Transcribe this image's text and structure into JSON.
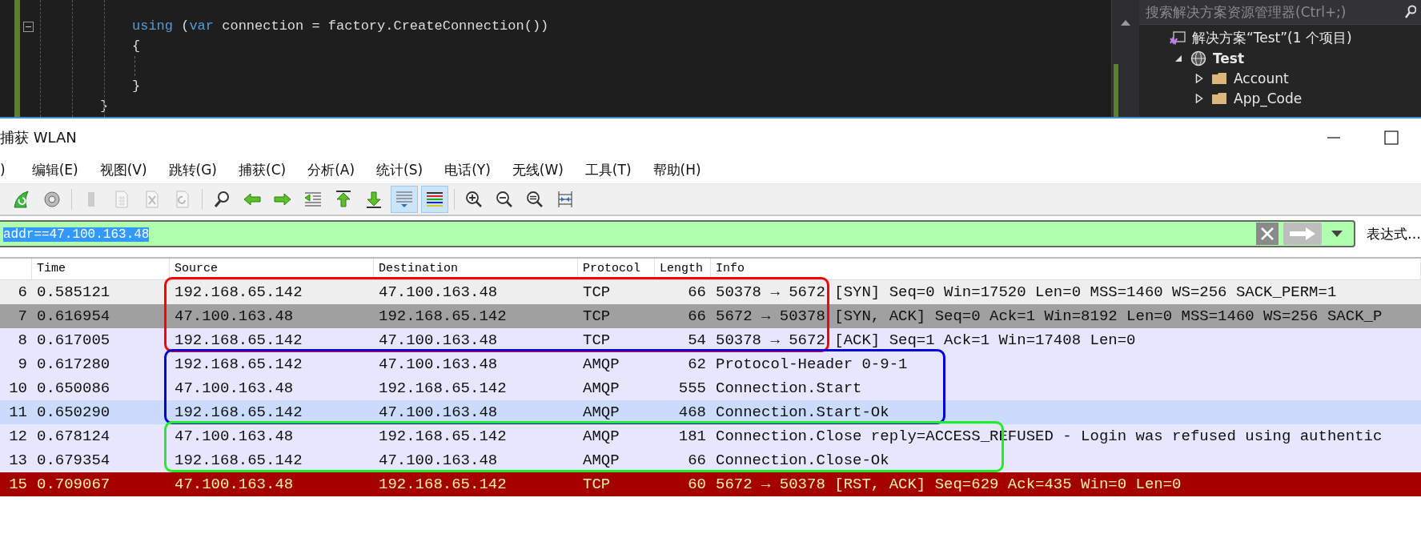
{
  "code_editor": {
    "lines": [
      {
        "kind": "inner",
        "tokens": [
          {
            "kind": "keyword",
            "text": "using"
          },
          {
            "kind": "plain",
            "text": " ("
          },
          {
            "kind": "keyword",
            "text": "var"
          },
          {
            "kind": "plain",
            "text": " connection = factory.CreateConnection())"
          }
        ]
      },
      {
        "kind": "inner",
        "tokens": [
          {
            "kind": "plain",
            "text": "{"
          }
        ]
      },
      {
        "kind": "blank"
      },
      {
        "kind": "inner",
        "tokens": [
          {
            "kind": "plain",
            "text": "}"
          }
        ]
      },
      {
        "kind": "outer",
        "tokens": [
          {
            "kind": "plain",
            "text": "}"
          }
        ]
      }
    ]
  },
  "solution_explorer": {
    "search": {
      "placeholder": "搜索解决方案资源管理器(Ctrl+;)"
    },
    "tree": [
      {
        "label": "解决方案“Test”(1 个项目)",
        "kind": "solution",
        "children": [
          {
            "label": "Test",
            "kind": "project",
            "expanded": true,
            "children": [
              {
                "label": "Account",
                "kind": "folder",
                "expanded": false
              },
              {
                "label": "App_Code",
                "kind": "folder",
                "expanded": false
              }
            ]
          }
        ]
      }
    ]
  },
  "window": {
    "title": "捕获 WLAN"
  },
  "menu": [
    ")",
    "编辑(E)",
    "视图(V)",
    "跳转(G)",
    "捕获(C)",
    "分析(A)",
    "统计(S)",
    "电话(Y)",
    "无线(W)",
    "工具(T)",
    "帮助(H)"
  ],
  "toolbar": [
    [
      {
        "kind": "restart",
        "pressed": false,
        "disabled": false
      },
      {
        "kind": "options",
        "pressed": false,
        "disabled": false
      }
    ],
    [
      {
        "kind": "save",
        "pressed": false,
        "disabled": true
      },
      {
        "kind": "file",
        "pressed": false,
        "disabled": true
      },
      {
        "kind": "close",
        "pressed": false,
        "disabled": true
      },
      {
        "kind": "reload",
        "pressed": false,
        "disabled": true
      }
    ],
    [
      {
        "kind": "find",
        "pressed": false,
        "disabled": false
      },
      {
        "kind": "back",
        "pressed": false,
        "disabled": false
      },
      {
        "kind": "forward",
        "pressed": false,
        "disabled": false
      },
      {
        "kind": "goto",
        "pressed": false,
        "disabled": false
      },
      {
        "kind": "first",
        "pressed": false,
        "disabled": false
      },
      {
        "kind": "last",
        "pressed": false,
        "disabled": false
      },
      {
        "kind": "autoscroll",
        "pressed": true,
        "disabled": false
      },
      {
        "kind": "colorize",
        "pressed": true,
        "disabled": false
      }
    ],
    [
      {
        "kind": "zoom-in",
        "pressed": false,
        "disabled": false
      },
      {
        "kind": "zoom-out",
        "pressed": false,
        "disabled": false
      },
      {
        "kind": "zoom-reset",
        "pressed": false,
        "disabled": false
      },
      {
        "kind": "resize",
        "pressed": false,
        "disabled": false
      }
    ]
  ],
  "filter": {
    "value": "addr==47.100.163.48",
    "expression_button": "表达式…"
  },
  "packets": {
    "columns": [
      "Time",
      "Source",
      "Destination",
      "Protocol",
      "Length",
      "Info"
    ],
    "groups": [
      {
        "frame": {
          "color": "#ff0000"
        },
        "rows": [
          {
            "no": "6",
            "time": "0.585121",
            "source": "192.168.65.142",
            "destination": "47.100.163.48",
            "protocol": "TCP",
            "length": "66",
            "info": "50378 → 5672 [SYN] Seq=0 Win=17520 Len=0 MSS=1460 WS=256 SACK_PERM=1",
            "color": "#eeeeee",
            "kind": "plain"
          },
          {
            "no": "7",
            "time": "0.616954",
            "source": "47.100.163.48",
            "destination": "192.168.65.142",
            "protocol": "TCP",
            "length": "66",
            "info": "5672 → 50378 [SYN, ACK] Seq=0 Ack=1 Win=8192 Len=0 MSS=1460 WS=256 SACK_P",
            "color": "#a0a0a0",
            "kind": "plain"
          },
          {
            "no": "8",
            "time": "0.617005",
            "source": "192.168.65.142",
            "destination": "47.100.163.48",
            "protocol": "TCP",
            "length": "54",
            "info": "50378 → 5672 [ACK] Seq=1 Ack=1 Win=17408 Len=0",
            "color": "#e7e6ff",
            "kind": "plain"
          }
        ]
      },
      {
        "frame": {
          "color": "#0000dd"
        },
        "rows": [
          {
            "no": "9",
            "time": "0.617280",
            "source": "192.168.65.142",
            "destination": "47.100.163.48",
            "protocol": "AMQP",
            "length": "62",
            "info": "Protocol-Header 0-9-1",
            "color": "#e7e6ff",
            "kind": "plain"
          },
          {
            "no": "10",
            "time": "0.650086",
            "source": "47.100.163.48",
            "destination": "192.168.65.142",
            "protocol": "AMQP",
            "length": "555",
            "info": "Connection.Start",
            "color": "#e7e6ff",
            "kind": "plain"
          },
          {
            "no": "11",
            "time": "0.650290",
            "source": "192.168.65.142",
            "destination": "47.100.163.48",
            "protocol": "AMQP",
            "length": "468",
            "info": "Connection.Start-Ok",
            "color": "#cadbfb",
            "kind": "plain"
          }
        ]
      },
      {
        "frame": {
          "color": "#22ee22"
        },
        "rows": [
          {
            "no": "12",
            "time": "0.678124",
            "source": "47.100.163.48",
            "destination": "192.168.65.142",
            "protocol": "AMQP",
            "length": "181",
            "info": "Connection.Close reply=ACCESS_REFUSED - Login was refused using authentic",
            "color": "#e7e6ff",
            "kind": "plain"
          },
          {
            "no": "13",
            "time": "0.679354",
            "source": "192.168.65.142",
            "destination": "47.100.163.48",
            "protocol": "AMQP",
            "length": "66",
            "info": "Connection.Close-Ok",
            "color": "#e7e6ff",
            "kind": "plain"
          }
        ]
      },
      {
        "rows": [
          {
            "no": "15",
            "time": "0.709067",
            "source": "47.100.163.48",
            "destination": "192.168.65.142",
            "protocol": "TCP",
            "length": "60",
            "info": "5672 → 50378 [RST, ACK] Seq=629 Ack=435 Win=0 Len=0",
            "color": "#a40000",
            "kind": "alert"
          }
        ]
      }
    ]
  }
}
